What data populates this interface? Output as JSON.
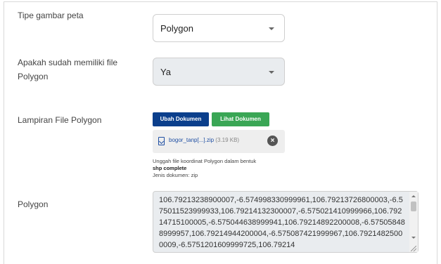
{
  "form": {
    "map_type": {
      "label": "Tipe gambar peta",
      "value": "Polygon"
    },
    "has_polygon": {
      "label_line1": "Apakah sudah memiliki file",
      "label_line2": "Polygon",
      "value": "Ya"
    },
    "attachment": {
      "label": "Lampiran File Polygon",
      "change_button": "Ubah Dokumen",
      "view_button": "Lihat Dokumen",
      "file_name": "bogor_tanp[...].zip",
      "file_size": "(3.19 KB)",
      "help_line1": "Unggah file koordinat Polygon dalam bentuk",
      "help_line2": "shp complete",
      "help_line3": "Jenis dokumen: zip"
    },
    "polygon": {
      "label": "Polygon",
      "value": "106.79213238900007,-6.574998330999961,106.79213726800003,-6.575011523999933,106.79214132300007,-6.575021410999966,106.79214715100005,-6.575044638999941,106.79214892200008,-6.575058488999957,106.79214944200004,-6.575087421999967,106.79214825000009,-6.5751201609999725,106.79214"
    }
  },
  "colors": {
    "primary_button": "#0b3f8c",
    "success_button": "#3aa655",
    "file_link": "#1f4fa3"
  }
}
